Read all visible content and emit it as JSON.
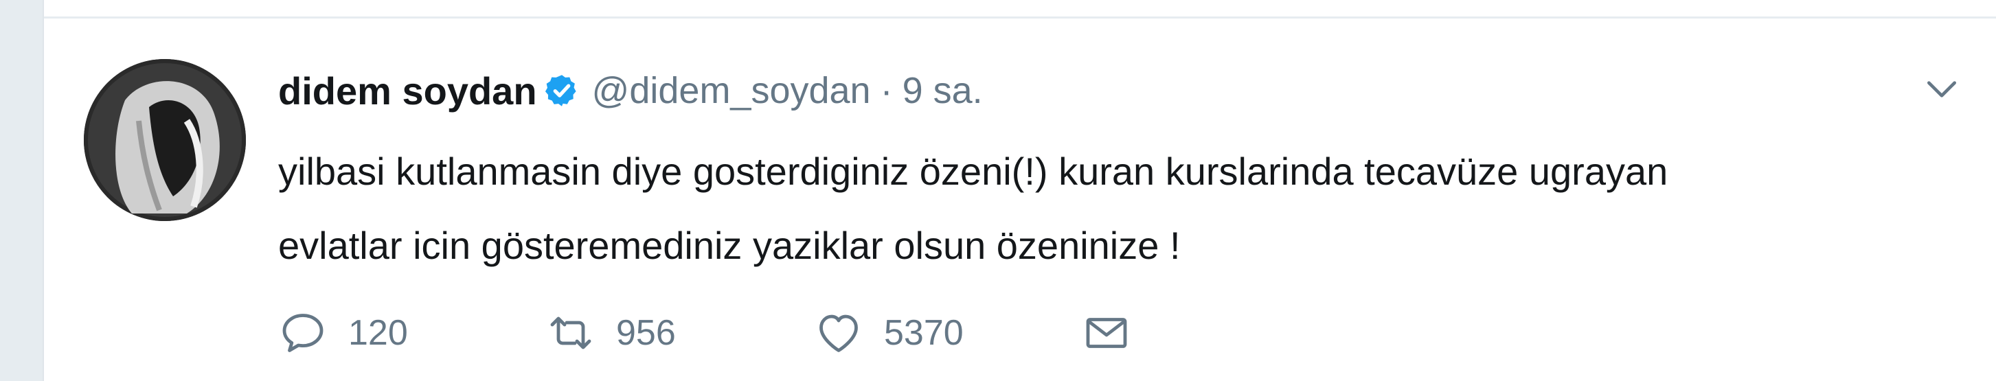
{
  "tweet": {
    "display_name": "didem soydan",
    "handle": "@didem_soydan",
    "separator": "·",
    "time": "9 sa.",
    "text_lines": [
      "yilbasi kutlanmasin diye gosterdiginiz özeni(!) kuran kurslarinda tecavüze ugrayan",
      "evlatlar icin gösteremediniz yaziklar olsun özeninize !"
    ],
    "counts": {
      "replies": "120",
      "retweets": "956",
      "likes": "5370"
    },
    "icons": {
      "verified": "verified-badge-icon",
      "menu": "chevron-down-icon",
      "reply": "reply-icon",
      "retweet": "retweet-icon",
      "like": "heart-icon",
      "dm": "envelope-icon"
    }
  },
  "colors": {
    "background": "#e6ecf0",
    "card": "#ffffff",
    "name": "#14171a",
    "secondary": "#657786",
    "verified": "#1da1f2"
  }
}
